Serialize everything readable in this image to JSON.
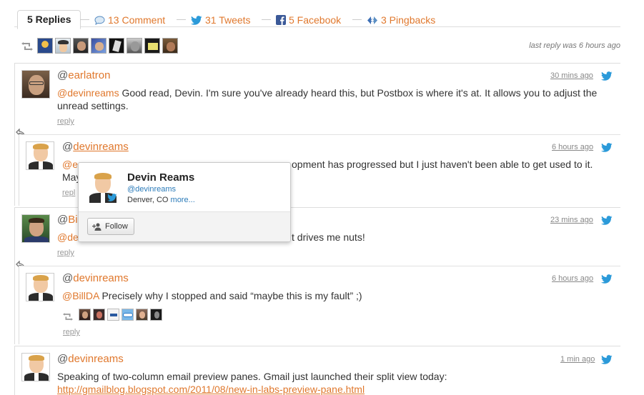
{
  "tabs": {
    "active": "5 Replies",
    "comment": "13 Comment",
    "tweets": "31 Tweets",
    "facebook": "5 Facebook",
    "pingbacks": "3 Pingbacks"
  },
  "last_reply": "last reply was 6 hours ago",
  "colors": {
    "accent": "#e0782d",
    "twitter": "#2b9ad9",
    "border": "#dddddd"
  },
  "comments": [
    {
      "handle": "earlatron",
      "time": "30 mins ago",
      "mention": "@devinreams",
      "text": " Good read, Devin. I'm sure you've already heard this, but Postbox is where it's at. It allows you to adjust the unread settings.",
      "reply": "reply"
    },
    {
      "handle": "devinreams",
      "time": "6 hours ago",
      "mention": "@ea",
      "text": "opment has progressed but I just haven't been able to get used to it.",
      "text_line2": "May",
      "reply": "repl"
    },
    {
      "handle": "Bill",
      "time": "23 mins ago",
      "mention": "@dev",
      "text": "t drives me nuts!",
      "reply": "reply"
    },
    {
      "handle": "devinreams",
      "time": "6 hours ago",
      "mention": "@BillDA",
      "text": " Precisely why I stopped and said “maybe this is my fault” ;)",
      "reply": "reply"
    },
    {
      "handle": "devinreams",
      "time": "1 min ago",
      "text": "Speaking of two-column email preview panes. Gmail just launched their split view today:",
      "link": "http://gmailblog.blogspot.com/2011/08/new-in-labs-preview-pane.html"
    }
  ],
  "hovercard": {
    "name": "Devin Reams",
    "handle": "@devinreams",
    "location": "Denver, CO",
    "more": "more...",
    "follow": "Follow"
  },
  "at": "@"
}
